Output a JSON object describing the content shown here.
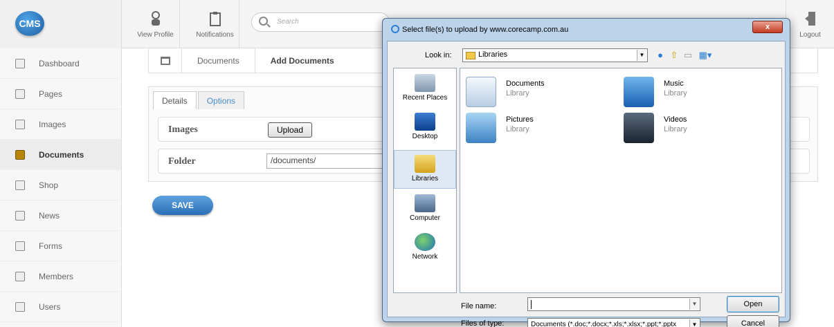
{
  "app": {
    "logo": "CMS"
  },
  "toolbar": {
    "view_profile": "View Profile",
    "notifications": "Notifications",
    "search_placeholder": "Search",
    "logout": "Logout"
  },
  "sidebar": {
    "items": [
      {
        "label": "Dashboard",
        "icon": "home-icon"
      },
      {
        "label": "Pages",
        "icon": "pages-icon"
      },
      {
        "label": "Images",
        "icon": "images-icon"
      },
      {
        "label": "Documents",
        "icon": "documents-icon",
        "active": true
      },
      {
        "label": "Shop",
        "icon": "cart-icon"
      },
      {
        "label": "News",
        "icon": "news-icon"
      },
      {
        "label": "Forms",
        "icon": "forms-icon"
      },
      {
        "label": "Members",
        "icon": "members-icon"
      },
      {
        "label": "Users",
        "icon": "users-icon"
      }
    ]
  },
  "breadcrumb": {
    "items": [
      "Documents",
      "Add Documents"
    ]
  },
  "tabs": [
    "Details",
    "Options"
  ],
  "form": {
    "images_label": "Images",
    "upload_label": "Upload",
    "folder_label": "Folder",
    "folder_value": "/documents/"
  },
  "save_label": "SAVE",
  "dialog": {
    "title": "Select file(s) to upload by www.corecamp.com.au",
    "close_label": "x",
    "look_in_label": "Look in:",
    "look_in_value": "Libraries",
    "places": [
      "Recent Places",
      "Desktop",
      "Libraries",
      "Computer",
      "Network"
    ],
    "selected_place": "Libraries",
    "files": [
      {
        "name": "Documents",
        "type": "Library"
      },
      {
        "name": "Music",
        "type": "Library"
      },
      {
        "name": "Pictures",
        "type": "Library"
      },
      {
        "name": "Videos",
        "type": "Library"
      }
    ],
    "file_name_label": "File name:",
    "file_name_value": "",
    "files_of_type_label": "Files of type:",
    "files_of_type_value": "Documents (*.doc;*.docx;*.xls;*.xlsx;*.ppt;*.pptx",
    "open_label": "Open",
    "cancel_label": "Cancel"
  }
}
